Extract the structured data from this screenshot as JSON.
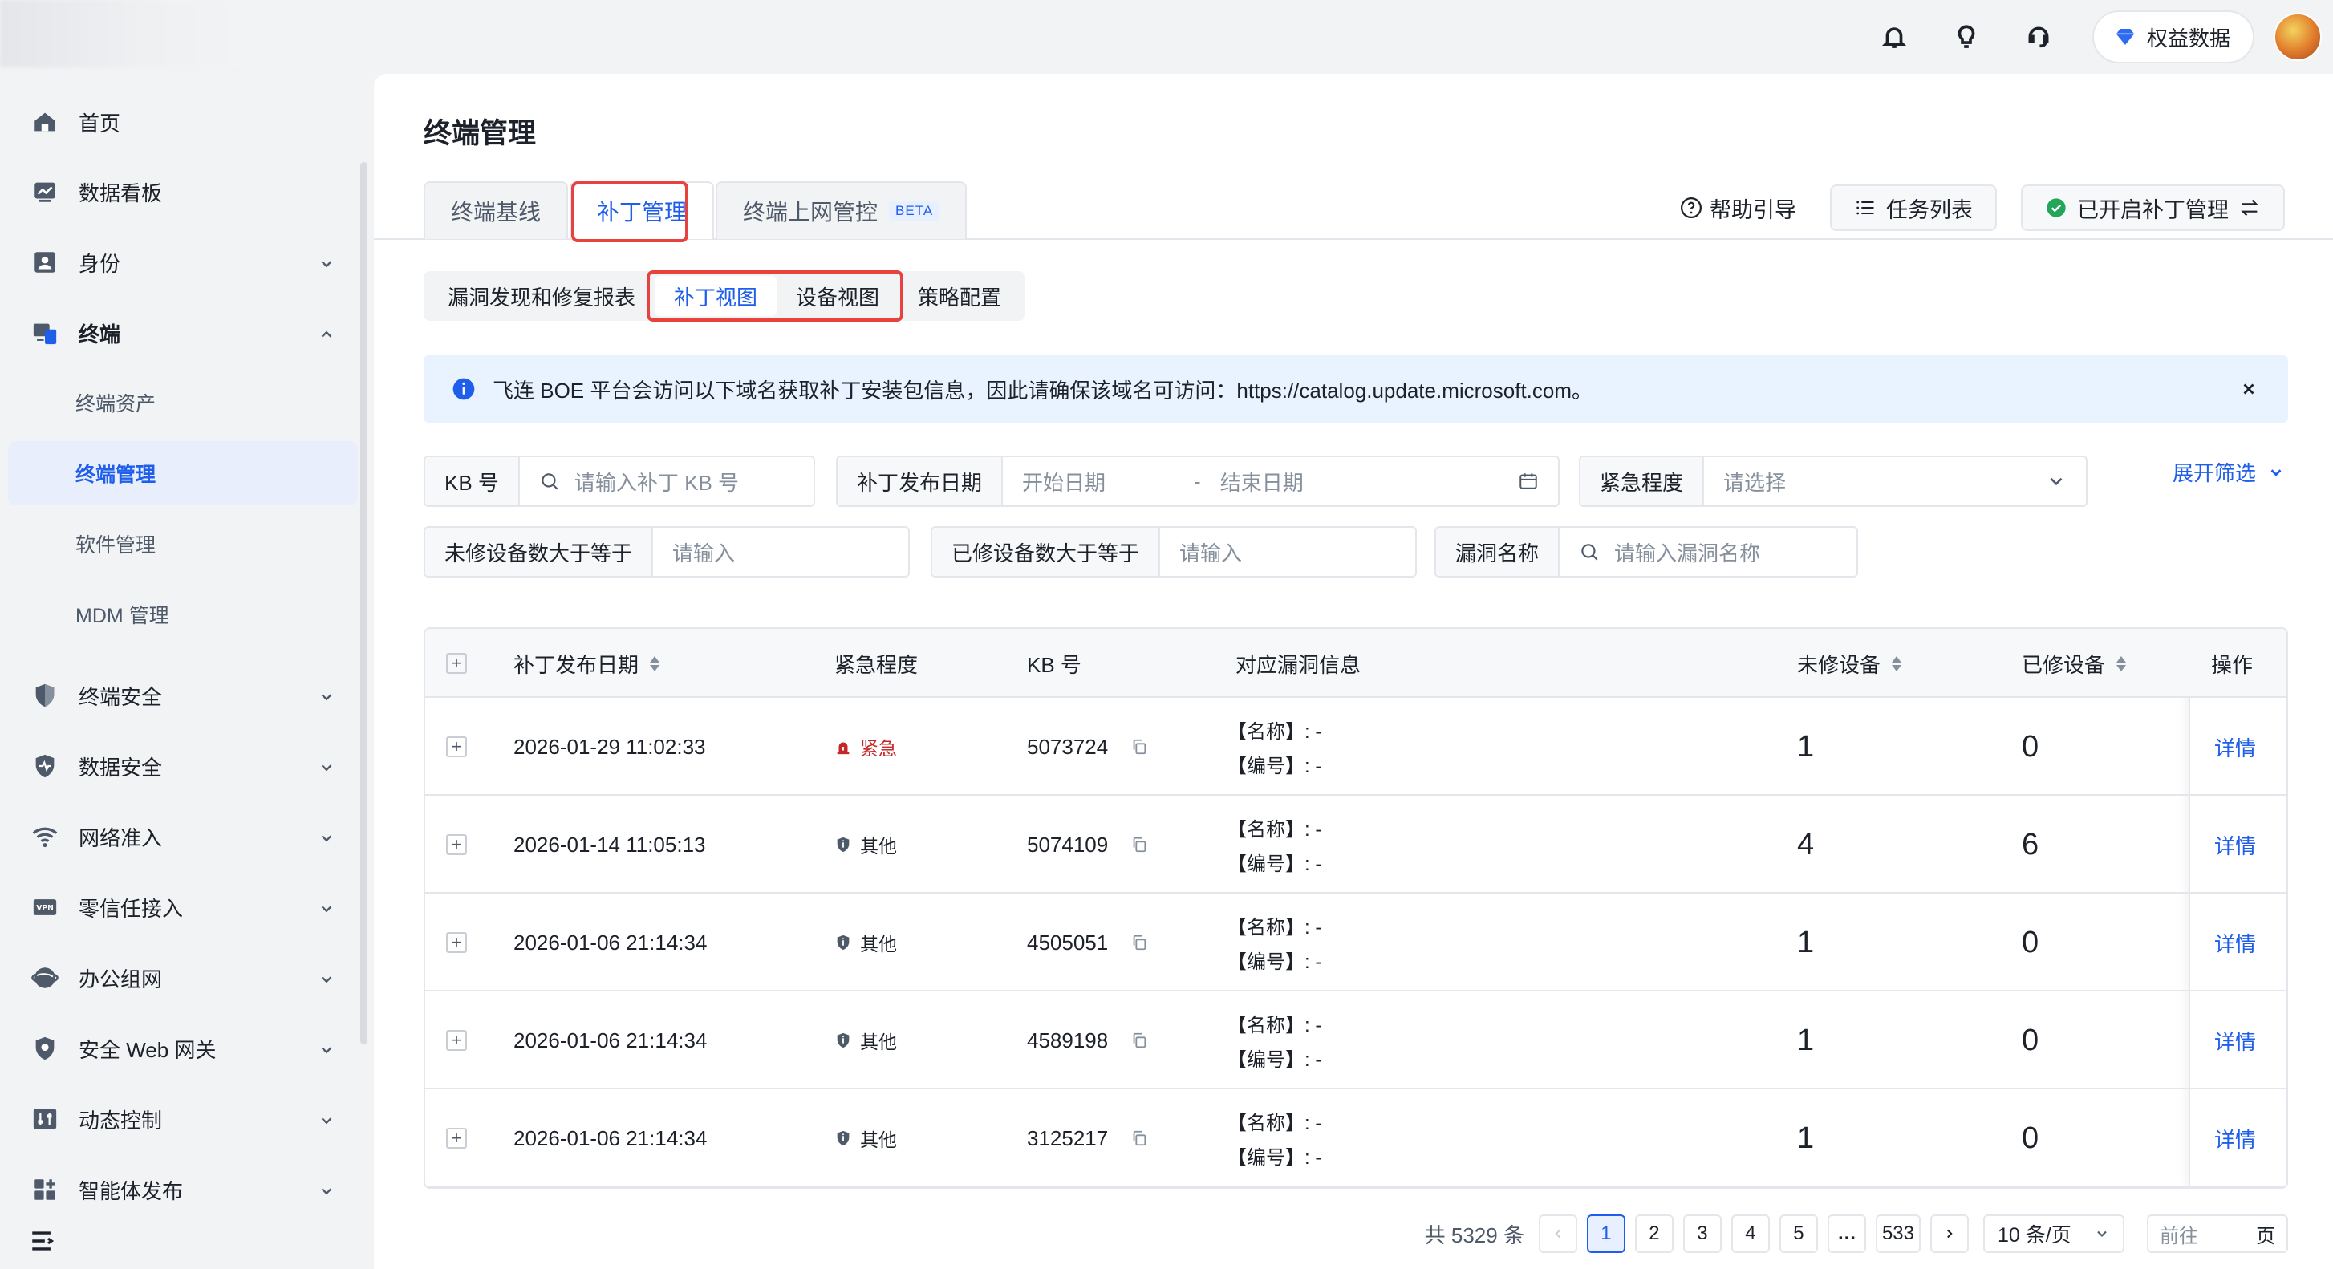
{
  "topbar": {
    "rights_label": "权益数据",
    "icons": [
      "bell-icon",
      "lightbulb-icon",
      "headset-icon"
    ]
  },
  "sidebar": {
    "items": [
      {
        "label": "首页",
        "icon": "home-icon"
      },
      {
        "label": "数据看板",
        "icon": "dashboard-icon"
      },
      {
        "label": "身份",
        "icon": "identity-icon"
      },
      {
        "label": "终端",
        "icon": "terminal-icon"
      },
      {
        "label": "终端资产"
      },
      {
        "label": "终端管理"
      },
      {
        "label": "软件管理"
      },
      {
        "label": "MDM 管理"
      },
      {
        "label": "终端安全",
        "icon": "shield-icon"
      },
      {
        "label": "数据安全",
        "icon": "data-shield-icon"
      },
      {
        "label": "网络准入",
        "icon": "wifi-icon"
      },
      {
        "label": "零信任接入",
        "icon": "vpn-icon"
      },
      {
        "label": "办公组网",
        "icon": "globe-icon"
      },
      {
        "label": "安全 Web 网关",
        "icon": "gateway-shield-icon"
      },
      {
        "label": "动态控制",
        "icon": "control-icon"
      },
      {
        "label": "智能体发布",
        "icon": "apps-icon"
      }
    ]
  },
  "main": {
    "title": "终端管理",
    "tabs": [
      {
        "label": "终端基线"
      },
      {
        "label": "补丁管理"
      },
      {
        "label": "终端上网管控",
        "badge": "BETA"
      }
    ],
    "actions": {
      "help": "帮助引导",
      "task_list": "任务列表",
      "patch_toggle": "已开启补丁管理"
    },
    "subtabs": [
      "漏洞发现和修复报表",
      "补丁视图",
      "设备视图",
      "策略配置"
    ],
    "alert": "飞连 BOE 平台会访问以下域名获取补丁安装包信息，因此请确保该域名可访问：https://catalog.update.microsoft.com。",
    "filters": {
      "kb_label": "KB 号",
      "kb_placeholder": "请输入补丁 KB 号",
      "date_label": "补丁发布日期",
      "date_start": "开始日期",
      "date_sep": "-",
      "date_end": "结束日期",
      "urgency_label": "紧急程度",
      "urgency_placeholder": "请选择",
      "expand": "展开筛选",
      "unfixed_label": "未修设备数大于等于",
      "unfixed_placeholder": "请输入",
      "fixed_label": "已修设备数大于等于",
      "fixed_placeholder": "请输入",
      "vuln_label": "漏洞名称",
      "vuln_placeholder": "请输入漏洞名称"
    },
    "table": {
      "columns": [
        "补丁发布日期",
        "紧急程度",
        "KB 号",
        "对应漏洞信息",
        "未修设备",
        "已修设备",
        "操作"
      ],
      "name_prefix": "【名称】: -",
      "id_prefix": "【编号】: -",
      "detail": "详情",
      "rows": [
        {
          "date": "2026-01-29 11:02:33",
          "urgency": "紧急",
          "urgency_level": "urgent",
          "kb": "5073724",
          "unfixed": "1",
          "fixed": "0"
        },
        {
          "date": "2026-01-14 11:05:13",
          "urgency": "其他",
          "urgency_level": "other",
          "kb": "5074109",
          "unfixed": "4",
          "fixed": "6"
        },
        {
          "date": "2026-01-06 21:14:34",
          "urgency": "其他",
          "urgency_level": "other",
          "kb": "4505051",
          "unfixed": "1",
          "fixed": "0"
        },
        {
          "date": "2026-01-06 21:14:34",
          "urgency": "其他",
          "urgency_level": "other",
          "kb": "4589198",
          "unfixed": "1",
          "fixed": "0"
        },
        {
          "date": "2026-01-06 21:14:34",
          "urgency": "其他",
          "urgency_level": "other",
          "kb": "3125217",
          "unfixed": "1",
          "fixed": "0"
        }
      ]
    },
    "pagination": {
      "total": "共 5329 条",
      "pages": [
        "1",
        "2",
        "3",
        "4",
        "5",
        "…",
        "533"
      ],
      "current": "1",
      "page_size": "10 条/页",
      "goto_prefix": "前往",
      "goto_suffix": "页"
    }
  },
  "colors": {
    "accent": "#1e5eea",
    "highlight_box": "#e8423f",
    "urgent": "#c62828",
    "alert_bg": "#e8f3ff"
  }
}
